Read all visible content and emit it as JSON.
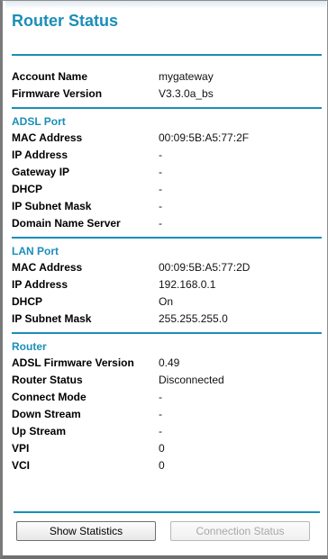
{
  "page_title": "Router Status",
  "account": {
    "rows": [
      {
        "label": "Account Name",
        "value": "mygateway"
      },
      {
        "label": "Firmware Version",
        "value": "V3.3.0a_bs"
      }
    ]
  },
  "adsl_port": {
    "title": "ADSL Port",
    "rows": [
      {
        "label": "MAC Address",
        "value": "00:09:5B:A5:77:2F"
      },
      {
        "label": "IP Address",
        "value": "-"
      },
      {
        "label": "Gateway IP",
        "value": "-"
      },
      {
        "label": "DHCP",
        "value": "-"
      },
      {
        "label": "IP Subnet Mask",
        "value": "-"
      },
      {
        "label": "Domain Name Server",
        "value": "-"
      }
    ]
  },
  "lan_port": {
    "title": "LAN Port",
    "rows": [
      {
        "label": "MAC Address",
        "value": "00:09:5B:A5:77:2D"
      },
      {
        "label": "IP Address",
        "value": "192.168.0.1"
      },
      {
        "label": "DHCP",
        "value": "On"
      },
      {
        "label": "IP Subnet Mask",
        "value": "255.255.255.0"
      }
    ]
  },
  "router": {
    "title": "Router",
    "rows": [
      {
        "label": "ADSL Firmware Version",
        "value": "0.49"
      },
      {
        "label": "Router Status",
        "value": "Disconnected"
      },
      {
        "label": "Connect Mode",
        "value": "-"
      },
      {
        "label": "Down Stream",
        "value": "-"
      },
      {
        "label": "Up Stream",
        "value": "-"
      },
      {
        "label": "VPI",
        "value": "0"
      },
      {
        "label": "VCI",
        "value": "0"
      }
    ]
  },
  "buttons": {
    "show_statistics": "Show Statistics",
    "connection_status": "Connection Status"
  },
  "colors": {
    "accent": "#1b8eb8"
  }
}
